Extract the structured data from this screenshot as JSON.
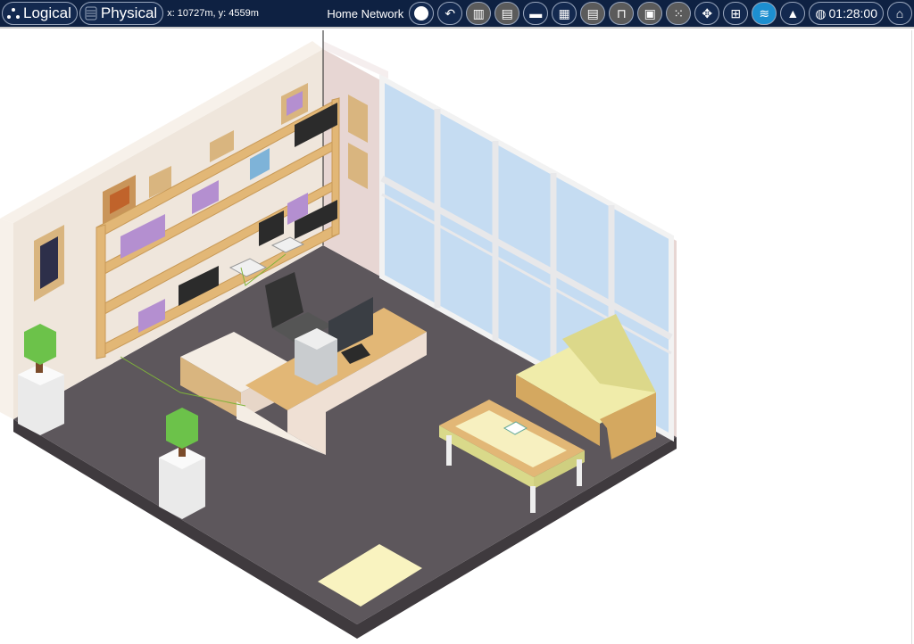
{
  "toolbar": {
    "logical_label": "Logical",
    "physical_label": "Physical",
    "coordinates": "x: 10727m, y: 4559m",
    "network_name": "Home Network",
    "clock": "01:28:00",
    "buttons": [
      {
        "icon": "navigation-compass-icon"
      },
      {
        "icon": "back-icon"
      },
      {
        "icon": "new-building-icon"
      },
      {
        "icon": "new-city-icon"
      },
      {
        "icon": "new-wiring-closet-icon"
      },
      {
        "icon": "new-rack-icon"
      },
      {
        "icon": "new-table-icon"
      },
      {
        "icon": "new-shelf-icon"
      },
      {
        "icon": "inventory-icon"
      },
      {
        "icon": "cluster-icon"
      },
      {
        "icon": "move-icon"
      },
      {
        "icon": "grid-icon"
      },
      {
        "icon": "wireless-icon",
        "active": true
      },
      {
        "icon": "background-image-icon"
      },
      {
        "icon": "home-icon"
      }
    ]
  },
  "colors": {
    "toolbar_bg": "#0e2142",
    "active_button": "#1d8fd0",
    "floor": "#5d575c"
  }
}
